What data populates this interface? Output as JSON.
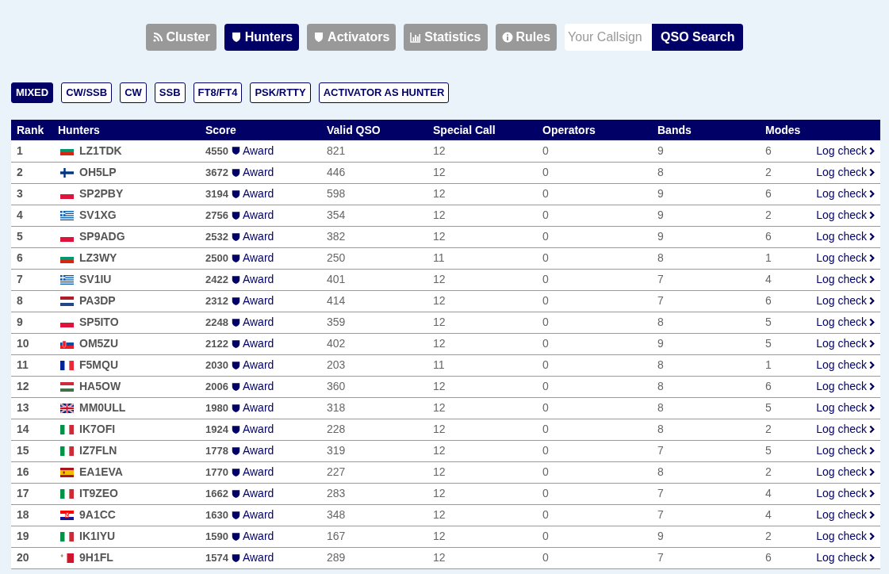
{
  "nav": [
    {
      "label": "Cluster",
      "kind": "rss",
      "selected": false
    },
    {
      "label": "Hunters",
      "kind": "shield",
      "selected": true
    },
    {
      "label": "Activators",
      "kind": "shield",
      "selected": false
    },
    {
      "label": "Statistics",
      "kind": "chart",
      "selected": false
    },
    {
      "label": "Rules",
      "kind": "info",
      "selected": false
    }
  ],
  "search": {
    "placeholder": "Your Callsign",
    "button": "QSO Search"
  },
  "filters": [
    {
      "label": "MIXED",
      "selected": true
    },
    {
      "label": "CW/SSB",
      "selected": false
    },
    {
      "label": "CW",
      "selected": false
    },
    {
      "label": "SSB",
      "selected": false
    },
    {
      "label": "FT8/FT4",
      "selected": false
    },
    {
      "label": "PSK/RTTY",
      "selected": false
    },
    {
      "label": "ACTIVATOR AS HUNTER",
      "selected": false
    }
  ],
  "table": {
    "columns": [
      "Rank",
      "Hunters",
      "Score",
      "Valid QSO",
      "Special Call",
      "Operators",
      "Bands",
      "Modes"
    ],
    "rows": [
      {
        "rank": "1",
        "kind": "bg",
        "call": "LZ1TDK",
        "score": "4550",
        "award": "Award",
        "valid": "821",
        "special": "12",
        "operators": "0",
        "bands": "9",
        "modes": "6",
        "link": "Log check"
      },
      {
        "rank": "2",
        "kind": "fi",
        "call": "OH5LP",
        "score": "3672",
        "award": "Award",
        "valid": "446",
        "special": "12",
        "operators": "0",
        "bands": "8",
        "modes": "2",
        "link": "Log check"
      },
      {
        "rank": "3",
        "kind": "pl",
        "call": "SP2PBY",
        "score": "3194",
        "award": "Award",
        "valid": "598",
        "special": "12",
        "operators": "0",
        "bands": "9",
        "modes": "6",
        "link": "Log check"
      },
      {
        "rank": "4",
        "kind": "gr",
        "call": "SV1XG",
        "score": "2756",
        "award": "Award",
        "valid": "354",
        "special": "12",
        "operators": "0",
        "bands": "9",
        "modes": "2",
        "link": "Log check"
      },
      {
        "rank": "5",
        "kind": "pl",
        "call": "SP9ADG",
        "score": "2532",
        "award": "Award",
        "valid": "382",
        "special": "12",
        "operators": "0",
        "bands": "9",
        "modes": "6",
        "link": "Log check"
      },
      {
        "rank": "6",
        "kind": "bg",
        "call": "LZ3WY",
        "score": "2500",
        "award": "Award",
        "valid": "250",
        "special": "11",
        "operators": "0",
        "bands": "8",
        "modes": "1",
        "link": "Log check"
      },
      {
        "rank": "7",
        "kind": "gr",
        "call": "SV1IU",
        "score": "2422",
        "award": "Award",
        "valid": "401",
        "special": "12",
        "operators": "0",
        "bands": "7",
        "modes": "4",
        "link": "Log check"
      },
      {
        "rank": "8",
        "kind": "nl",
        "call": "PA3DP",
        "score": "2312",
        "award": "Award",
        "valid": "414",
        "special": "12",
        "operators": "0",
        "bands": "7",
        "modes": "6",
        "link": "Log check"
      },
      {
        "rank": "9",
        "kind": "pl",
        "call": "SP5ITO",
        "score": "2248",
        "award": "Award",
        "valid": "359",
        "special": "12",
        "operators": "0",
        "bands": "8",
        "modes": "5",
        "link": "Log check"
      },
      {
        "rank": "10",
        "kind": "sk",
        "call": "OM5ZU",
        "score": "2122",
        "award": "Award",
        "valid": "402",
        "special": "12",
        "operators": "0",
        "bands": "9",
        "modes": "5",
        "link": "Log check"
      },
      {
        "rank": "11",
        "kind": "fr",
        "call": "F5MQU",
        "score": "2030",
        "award": "Award",
        "valid": "203",
        "special": "11",
        "operators": "0",
        "bands": "8",
        "modes": "1",
        "link": "Log check"
      },
      {
        "rank": "12",
        "kind": "hu",
        "call": "HA5OW",
        "score": "2006",
        "award": "Award",
        "valid": "360",
        "special": "12",
        "operators": "0",
        "bands": "8",
        "modes": "6",
        "link": "Log check"
      },
      {
        "rank": "13",
        "kind": "gb",
        "call": "MM0ULL",
        "score": "1980",
        "award": "Award",
        "valid": "318",
        "special": "12",
        "operators": "0",
        "bands": "8",
        "modes": "5",
        "link": "Log check"
      },
      {
        "rank": "14",
        "kind": "it",
        "call": "IK7OFI",
        "score": "1924",
        "award": "Award",
        "valid": "228",
        "special": "12",
        "operators": "0",
        "bands": "8",
        "modes": "2",
        "link": "Log check"
      },
      {
        "rank": "15",
        "kind": "it",
        "call": "IZ7FLN",
        "score": "1778",
        "award": "Award",
        "valid": "319",
        "special": "12",
        "operators": "0",
        "bands": "7",
        "modes": "5",
        "link": "Log check"
      },
      {
        "rank": "16",
        "kind": "es",
        "call": "EA1EVA",
        "score": "1770",
        "award": "Award",
        "valid": "227",
        "special": "12",
        "operators": "0",
        "bands": "8",
        "modes": "2",
        "link": "Log check"
      },
      {
        "rank": "17",
        "kind": "it",
        "call": "IT9ZEO",
        "score": "1662",
        "award": "Award",
        "valid": "283",
        "special": "12",
        "operators": "0",
        "bands": "7",
        "modes": "4",
        "link": "Log check"
      },
      {
        "rank": "18",
        "kind": "hr",
        "call": "9A1CC",
        "score": "1630",
        "award": "Award",
        "valid": "348",
        "special": "12",
        "operators": "0",
        "bands": "7",
        "modes": "4",
        "link": "Log check"
      },
      {
        "rank": "19",
        "kind": "it",
        "call": "IK1IYU",
        "score": "1590",
        "award": "Award",
        "valid": "167",
        "special": "12",
        "operators": "0",
        "bands": "9",
        "modes": "2",
        "link": "Log check"
      },
      {
        "rank": "20",
        "kind": "mt",
        "call": "9H1FL",
        "score": "1574",
        "award": "Award",
        "valid": "289",
        "special": "12",
        "operators": "0",
        "bands": "7",
        "modes": "6",
        "link": "Log check"
      }
    ]
  }
}
